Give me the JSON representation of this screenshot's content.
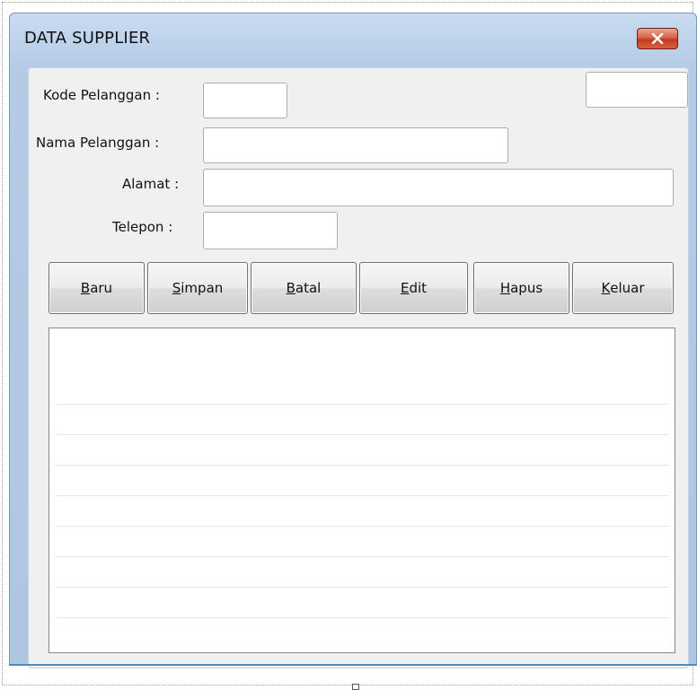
{
  "window": {
    "title": "DATA SUPPLIER",
    "close_symbol": "close-x"
  },
  "form": {
    "kode_label": "Kode Pelanggan :",
    "kode_value": "",
    "nama_label": "Nama Pelanggan :",
    "nama_value": "",
    "alamat_label": "Alamat :",
    "alamat_value": "",
    "telepon_label": "Telepon :",
    "telepon_value": "",
    "extra_value": ""
  },
  "buttons": {
    "baru": {
      "mnemonic": "B",
      "rest": "aru"
    },
    "simpan": {
      "mnemonic": "S",
      "rest": "impan"
    },
    "batal": {
      "mnemonic": "B",
      "rest": "atal"
    },
    "edit": {
      "mnemonic": "E",
      "rest": "dit"
    },
    "hapus": {
      "mnemonic": "H",
      "rest": "apus"
    },
    "keluar": {
      "mnemonic": "K",
      "rest": "eluar"
    }
  },
  "grid": {
    "rows": []
  },
  "colors": {
    "title_gradient": "#b4cbe6",
    "close_button": "#c3391f",
    "accent_line": "#4f8ab8"
  }
}
